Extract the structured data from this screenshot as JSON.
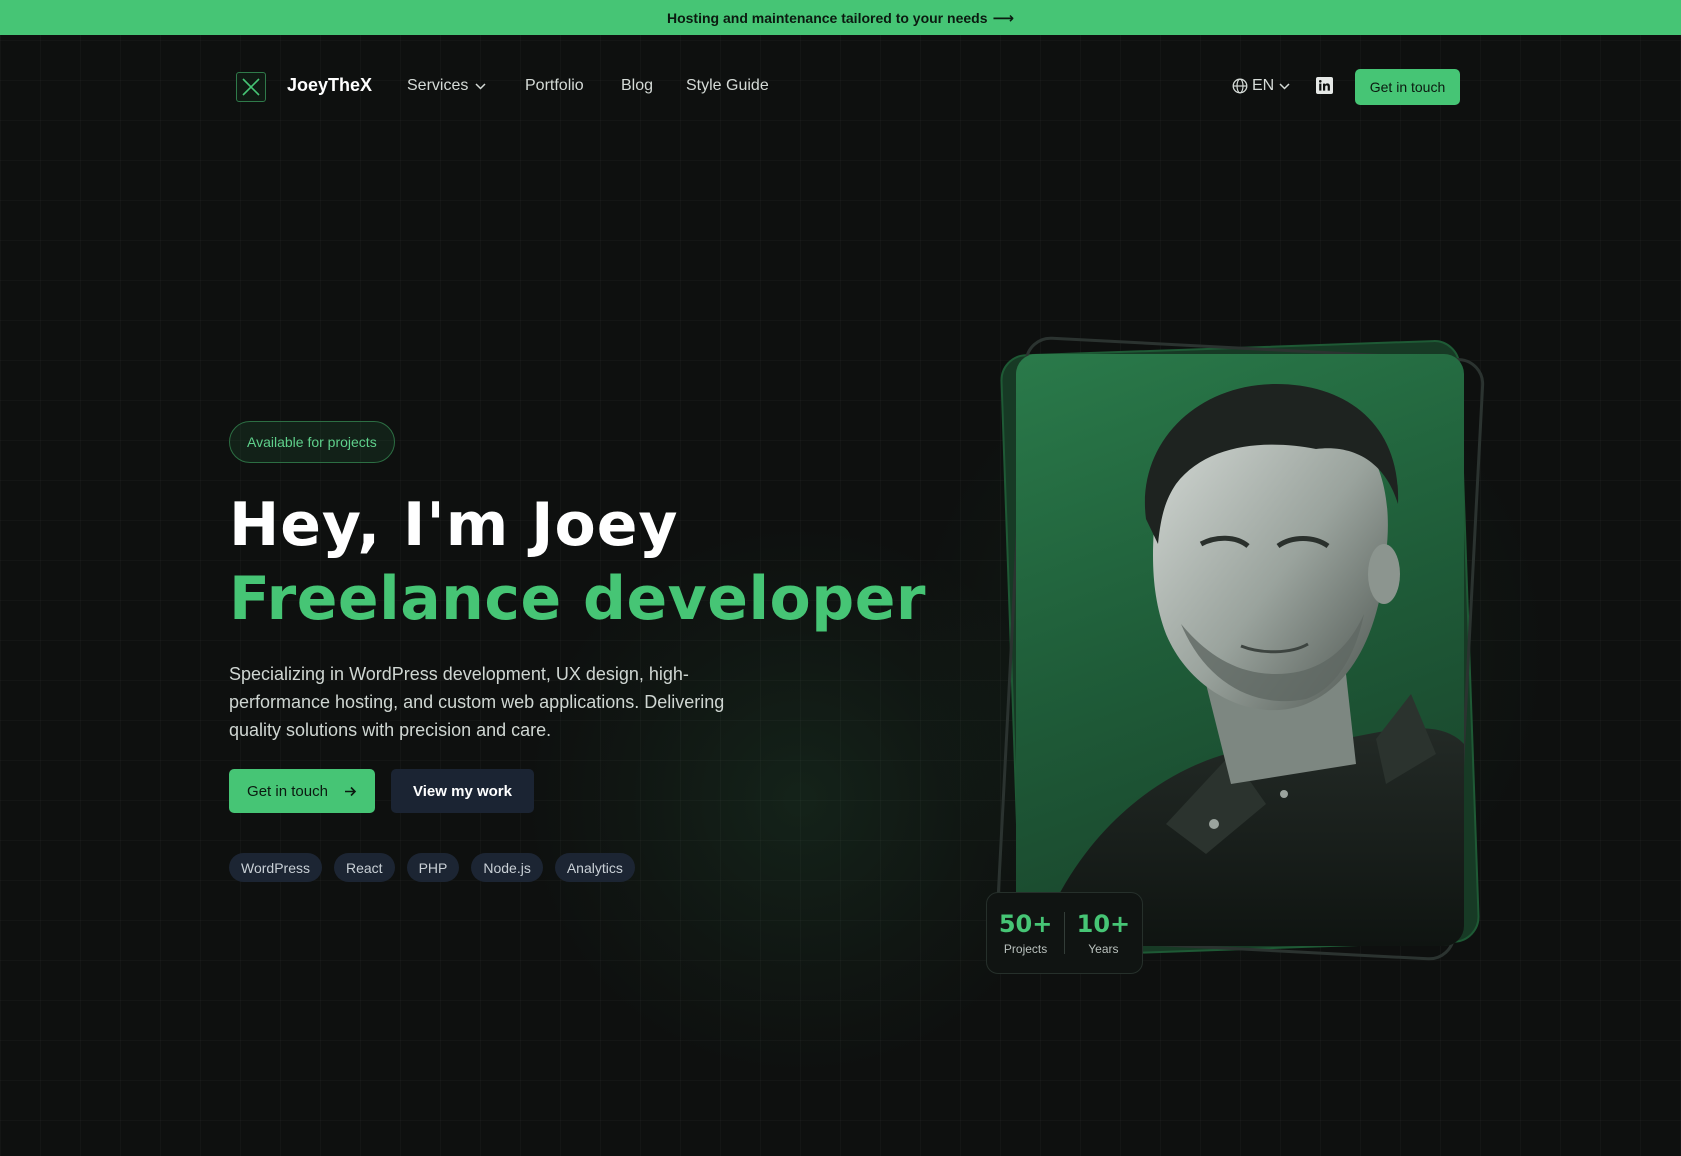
{
  "announcement": {
    "text": "Hosting and maintenance tailored to your needs",
    "arrow": "⟶"
  },
  "header": {
    "brand": "JoeyTheX",
    "nav": [
      {
        "label": "Services"
      },
      {
        "label": "Portfolio"
      },
      {
        "label": "Blog"
      },
      {
        "label": "Style Guide"
      }
    ],
    "language": "EN",
    "cta_label": "Get in touch"
  },
  "hero": {
    "badge": "Available for projects",
    "heading_line1": "Hey, I'm Joey",
    "heading_line2": "Freelance developer",
    "description": "Specializing in WordPress development, UX design, high-performance hosting, and custom web applications. Delivering quality solutions with precision and care.",
    "primary_cta": "Get in touch",
    "secondary_cta": "View my work",
    "tags": [
      "WordPress",
      "React",
      "PHP",
      "Node.js",
      "Analytics"
    ]
  },
  "stats": [
    {
      "value": "50+",
      "label": "Projects"
    },
    {
      "value": "10+",
      "label": "Years"
    }
  ],
  "colors": {
    "accent": "#46c575",
    "background": "#0e100f",
    "secondary_button": "#1b2433"
  },
  "icons": {
    "logo": "x-logo-icon",
    "services_chevron": "chevron-down-icon",
    "language": "globe-icon",
    "language_chevron": "chevron-down-icon",
    "social": "linkedin-icon",
    "cta_arrow": "arrow-right-icon"
  }
}
